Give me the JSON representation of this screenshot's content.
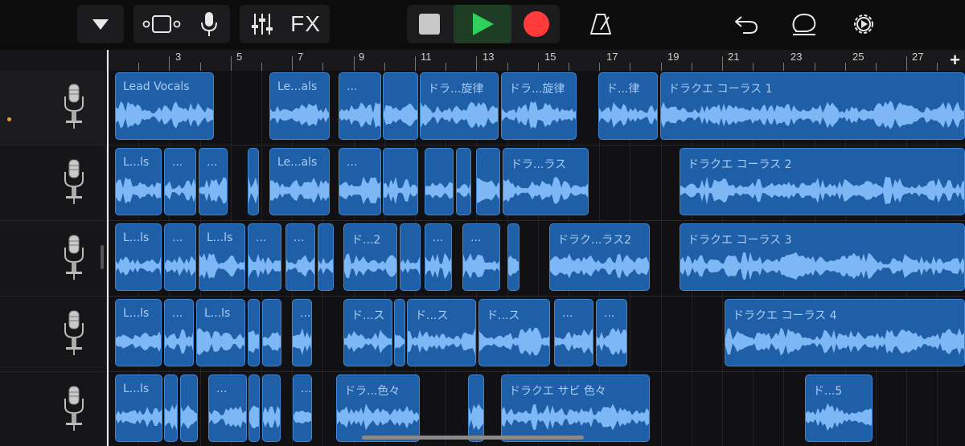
{
  "toolbar": {
    "fx_label": "FX",
    "buttons": [
      "track-menu",
      "tracks-view",
      "microphone",
      "mixer",
      "fx",
      "stop",
      "play",
      "record",
      "metronome",
      "undo",
      "loop-browser",
      "settings"
    ],
    "colors": {
      "play": "#2fd05b",
      "record": "#ff3b3b",
      "stop": "#c8c8c8"
    }
  },
  "ruler": {
    "bars": [
      "3",
      "5",
      "7",
      "9",
      "11",
      "13",
      "15",
      "17",
      "19",
      "21",
      "23",
      "25",
      "27"
    ],
    "add_label": "+"
  },
  "tracks": [
    {
      "instrument": "microphone-icon",
      "selected": true,
      "regions": [
        {
          "label": "Lead Vocals"
        },
        {
          "label": "Le...als"
        },
        {
          "label": "..."
        },
        {
          "label": ""
        },
        {
          "label": "ドラ...旋律"
        },
        {
          "label": "ドラ...旋律"
        },
        {
          "label": "ド...律"
        },
        {
          "label": "ドラクエ コーラス 1"
        }
      ]
    },
    {
      "instrument": "microphone-icon",
      "selected": false,
      "regions": [
        {
          "label": "L...ls"
        },
        {
          "label": "..."
        },
        {
          "label": "..."
        },
        {
          "label": ""
        },
        {
          "label": "Le...als"
        },
        {
          "label": "..."
        },
        {
          "label": ""
        },
        {
          "label": ""
        },
        {
          "label": ""
        },
        {
          "label": ""
        },
        {
          "label": "ドラ...ラス"
        },
        {
          "label": "ドラクエ コーラス 2"
        }
      ]
    },
    {
      "instrument": "microphone-icon",
      "selected": false,
      "regions": [
        {
          "label": "L...ls"
        },
        {
          "label": "..."
        },
        {
          "label": "L...ls"
        },
        {
          "label": "..."
        },
        {
          "label": "..."
        },
        {
          "label": ""
        },
        {
          "label": "ド...2"
        },
        {
          "label": ""
        },
        {
          "label": "..."
        },
        {
          "label": "..."
        },
        {
          "label": ""
        },
        {
          "label": "ドラク...ラス2"
        },
        {
          "label": "ドラクエ コーラス 3"
        }
      ]
    },
    {
      "instrument": "microphone-icon",
      "selected": false,
      "regions": [
        {
          "label": "L...ls"
        },
        {
          "label": "..."
        },
        {
          "label": "L...ls"
        },
        {
          "label": ""
        },
        {
          "label": ""
        },
        {
          "label": "..."
        },
        {
          "label": "ド...ス"
        },
        {
          "label": ""
        },
        {
          "label": "ド...ス"
        },
        {
          "label": "ド...ス"
        },
        {
          "label": "..."
        },
        {
          "label": "..."
        },
        {
          "label": "ドラクエ コーラス 4"
        }
      ]
    },
    {
      "instrument": "microphone-icon",
      "selected": false,
      "regions": [
        {
          "label": "L...ls"
        },
        {
          "label": ""
        },
        {
          "label": ""
        },
        {
          "label": "..."
        },
        {
          "label": ""
        },
        {
          "label": ""
        },
        {
          "label": "..."
        },
        {
          "label": "ドラ...色々"
        },
        {
          "label": ""
        },
        {
          "label": "ドラクエ サビ 色々"
        },
        {
          "label": "ド...5"
        }
      ]
    }
  ]
}
